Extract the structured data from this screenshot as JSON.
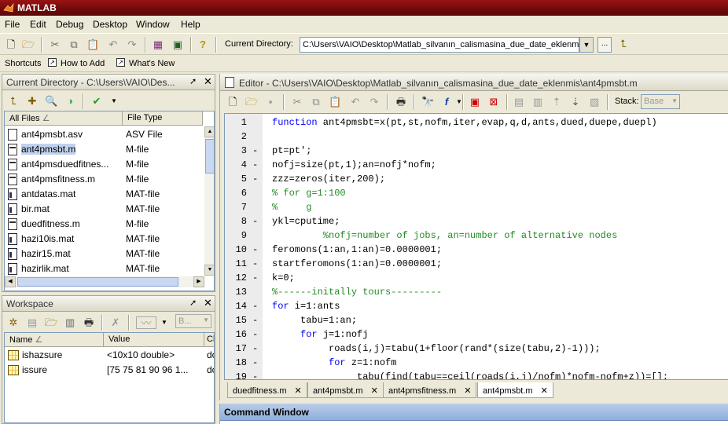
{
  "window": {
    "title": "MATLAB"
  },
  "menu": [
    "File",
    "Edit",
    "Debug",
    "Desktop",
    "Window",
    "Help"
  ],
  "toolbar": {
    "current_directory_label": "Current Directory:",
    "current_directory_value": "C:\\Users\\VAIO\\Desktop\\Matlab_silvanın_calismasina_due_date_eklenmis",
    "browse_label": "..."
  },
  "shortcuts": {
    "label": "Shortcuts",
    "items": [
      "How to Add",
      "What's New"
    ]
  },
  "current_directory_panel": {
    "title": "Current Directory - C:\\Users\\VAIO\\Des...",
    "columns": [
      "All Files",
      "File Type"
    ],
    "files": [
      {
        "name": "ant4pmsbt.asv",
        "type": "ASV File",
        "icon": "asv-file-icon"
      },
      {
        "name": "ant4pmsbt.m",
        "type": "M-file",
        "icon": "m-file-icon",
        "selected": true
      },
      {
        "name": "ant4pmsduedfitnes...",
        "type": "M-file",
        "icon": "m-file-icon"
      },
      {
        "name": "ant4pmsfitness.m",
        "type": "M-file",
        "icon": "m-file-icon"
      },
      {
        "name": "antdatas.mat",
        "type": "MAT-file",
        "icon": "mat-file-icon"
      },
      {
        "name": "bir.mat",
        "type": "MAT-file",
        "icon": "mat-file-icon"
      },
      {
        "name": "duedfitness.m",
        "type": "M-file",
        "icon": "m-file-icon"
      },
      {
        "name": "hazi10is.mat",
        "type": "MAT-file",
        "icon": "mat-file-icon"
      },
      {
        "name": "hazir15.mat",
        "type": "MAT-file",
        "icon": "mat-file-icon"
      },
      {
        "name": "hazirlik.mat",
        "type": "MAT-file",
        "icon": "mat-file-icon"
      }
    ]
  },
  "workspace_panel": {
    "title": "Workspace",
    "stack_value": "B...",
    "columns": [
      "Name",
      "Value",
      "Cl"
    ],
    "vars": [
      {
        "name": "ishazsure",
        "value": "<10x10 double>",
        "class": "do"
      },
      {
        "name": "issure",
        "value": "[75 75 81 90 96 1...",
        "class": "do"
      }
    ]
  },
  "editor": {
    "title": "Editor - C:\\Users\\VAIO\\Desktop\\Matlab_silvanın_calismasina_due_date_eklenmis\\ant4pmsbt.m",
    "stack_label": "Stack:",
    "stack_value": "Base",
    "lines": [
      {
        "n": "1",
        "dash": "",
        "segs": [
          {
            "t": "function",
            "c": "kw"
          },
          {
            "t": " ant4pmsbt=x(pt,st,nofm,iter,evap,q,d,ants,dued,duepe,duepl)",
            "c": ""
          }
        ]
      },
      {
        "n": "2",
        "dash": "",
        "segs": []
      },
      {
        "n": "3",
        "dash": "-",
        "segs": [
          {
            "t": "pt=pt';",
            "c": ""
          }
        ]
      },
      {
        "n": "4",
        "dash": "-",
        "segs": [
          {
            "t": "nofj=size(pt,1);an=nofj*nofm;",
            "c": ""
          }
        ]
      },
      {
        "n": "5",
        "dash": "-",
        "segs": [
          {
            "t": "zzz=zeros(iter,200);",
            "c": ""
          }
        ]
      },
      {
        "n": "6",
        "dash": "",
        "segs": [
          {
            "t": "% for g=1:100",
            "c": "cm"
          }
        ]
      },
      {
        "n": "7",
        "dash": "",
        "segs": [
          {
            "t": "%     g",
            "c": "cm"
          }
        ]
      },
      {
        "n": "8",
        "dash": "-",
        "segs": [
          {
            "t": "ykl=cputime;",
            "c": ""
          }
        ]
      },
      {
        "n": "9",
        "dash": "",
        "segs": [
          {
            "t": "         %nofj=number of jobs, an=number of alternative nodes",
            "c": "cm"
          }
        ]
      },
      {
        "n": "10",
        "dash": "-",
        "segs": [
          {
            "t": "feromons(1:an,1:an)=0.0000001;",
            "c": ""
          }
        ]
      },
      {
        "n": "11",
        "dash": "-",
        "segs": [
          {
            "t": "startferomons(1:an)=0.0000001;",
            "c": ""
          }
        ]
      },
      {
        "n": "12",
        "dash": "-",
        "segs": [
          {
            "t": "k=0;",
            "c": ""
          }
        ]
      },
      {
        "n": "13",
        "dash": "",
        "segs": [
          {
            "t": "%------initally tours---------",
            "c": "cm"
          }
        ]
      },
      {
        "n": "14",
        "dash": "-",
        "segs": [
          {
            "t": "for",
            "c": "kw"
          },
          {
            "t": " i=1:ants",
            "c": ""
          }
        ]
      },
      {
        "n": "15",
        "dash": "-",
        "segs": [
          {
            "t": "     tabu=1:an;",
            "c": ""
          }
        ]
      },
      {
        "n": "16",
        "dash": "-",
        "segs": [
          {
            "t": "     ",
            "c": ""
          },
          {
            "t": "for",
            "c": "kw"
          },
          {
            "t": " j=1:nofj",
            "c": ""
          }
        ]
      },
      {
        "n": "17",
        "dash": "-",
        "segs": [
          {
            "t": "          roads(i,j)=tabu(1+floor(rand*(size(tabu,2)-1)));",
            "c": ""
          }
        ]
      },
      {
        "n": "18",
        "dash": "-",
        "segs": [
          {
            "t": "          ",
            "c": ""
          },
          {
            "t": "for",
            "c": "kw"
          },
          {
            "t": " z=1:nofm",
            "c": ""
          }
        ]
      },
      {
        "n": "19",
        "dash": "-",
        "segs": [
          {
            "t": "               tabu(find(tabu==ceil(roads(i,j)/nofm)*nofm-nofm+z))=[];",
            "c": ""
          }
        ]
      }
    ],
    "tabs": [
      "duedfitness.m",
      "ant4pmsbt.m",
      "ant4pmsfitness.m",
      "ant4pmsbt.m"
    ]
  },
  "command_window": {
    "title": "Command Window"
  }
}
